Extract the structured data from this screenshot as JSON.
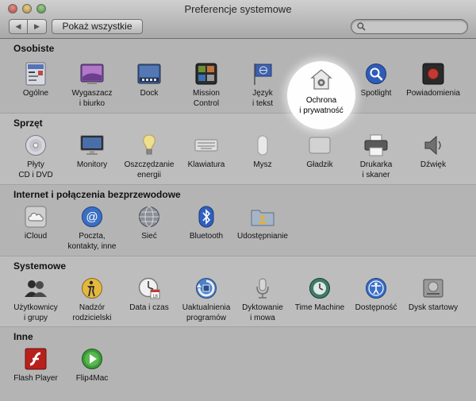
{
  "window": {
    "title": "Preferencje systemowe"
  },
  "toolbar": {
    "back_label": "◀",
    "forward_label": "▶",
    "show_all_label": "Pokaż wszystkie",
    "search": {
      "value": "",
      "placeholder": ""
    }
  },
  "sections": [
    {
      "title": "Osobiste",
      "items": [
        {
          "line1": "Ogólne",
          "line2": "",
          "icon": "general-icon"
        },
        {
          "line1": "Wygaszacz",
          "line2": "i biurko",
          "icon": "desktop-screensaver-icon"
        },
        {
          "line1": "Dock",
          "line2": "",
          "icon": "dock-icon"
        },
        {
          "line1": "Mission",
          "line2": "Control",
          "icon": "mission-control-icon"
        },
        {
          "line1": "Język",
          "line2": "i tekst",
          "icon": "language-flag-icon"
        },
        {
          "line1": "Ochrona",
          "line2": "i prywatność",
          "icon": "security-house-icon"
        },
        {
          "line1": "Spotlight",
          "line2": "",
          "icon": "spotlight-magnifier-icon"
        },
        {
          "line1": "Powiadomienia",
          "line2": "",
          "icon": "notifications-icon"
        }
      ]
    },
    {
      "title": "Sprzęt",
      "items": [
        {
          "line1": "Płyty",
          "line2": "CD i DVD",
          "icon": "cd-dvd-icon"
        },
        {
          "line1": "Monitory",
          "line2": "",
          "icon": "monitor-icon"
        },
        {
          "line1": "Oszczędzanie",
          "line2": "energii",
          "icon": "lightbulb-icon"
        },
        {
          "line1": "Klawiatura",
          "line2": "",
          "icon": "keyboard-icon"
        },
        {
          "line1": "Mysz",
          "line2": "",
          "icon": "mouse-icon"
        },
        {
          "line1": "Gładzik",
          "line2": "",
          "icon": "trackpad-icon"
        },
        {
          "line1": "Drukarka",
          "line2": "i skaner",
          "icon": "printer-icon"
        },
        {
          "line1": "Dźwięk",
          "line2": "",
          "icon": "speaker-icon"
        }
      ]
    },
    {
      "title": "Internet i połączenia bezprzewodowe",
      "items": [
        {
          "line1": "iCloud",
          "line2": "",
          "icon": "icloud-icon"
        },
        {
          "line1": "Poczta,",
          "line2": "kontakty, inne",
          "icon": "mail-at-icon"
        },
        {
          "line1": "Sieć",
          "line2": "",
          "icon": "network-globe-icon"
        },
        {
          "line1": "Bluetooth",
          "line2": "",
          "icon": "bluetooth-icon"
        },
        {
          "line1": "Udostępnianie",
          "line2": "",
          "icon": "sharing-folder-icon"
        }
      ]
    },
    {
      "title": "Systemowe",
      "items": [
        {
          "line1": "Użytkownicy",
          "line2": "i grupy",
          "icon": "users-icon"
        },
        {
          "line1": "Nadzór",
          "line2": "rodzicielski",
          "icon": "parental-controls-icon"
        },
        {
          "line1": "Data i czas",
          "line2": "",
          "icon": "clock-icon"
        },
        {
          "line1": "Uaktualnienia",
          "line2": "programów",
          "icon": "software-update-icon"
        },
        {
          "line1": "Dyktowanie",
          "line2": "i mowa",
          "icon": "microphone-icon"
        },
        {
          "line1": "Time Machine",
          "line2": "",
          "icon": "time-machine-icon"
        },
        {
          "line1": "Dostępność",
          "line2": "",
          "icon": "accessibility-icon"
        },
        {
          "line1": "Dysk startowy",
          "line2": "",
          "icon": "startup-disk-icon"
        }
      ]
    },
    {
      "title": "Inne",
      "items": [
        {
          "line1": "Flash Player",
          "line2": "",
          "icon": "flash-player-icon"
        },
        {
          "line1": "Flip4Mac",
          "line2": "",
          "icon": "flip4mac-icon"
        }
      ]
    }
  ]
}
